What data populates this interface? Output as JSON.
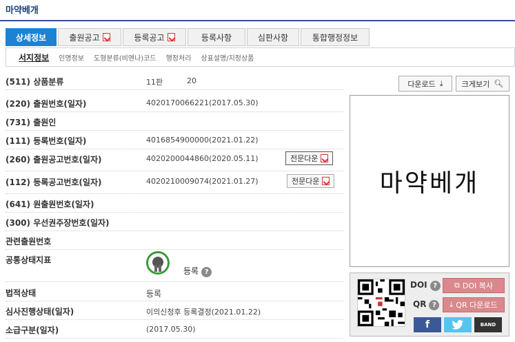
{
  "page": {
    "title": "마약베개"
  },
  "tabs": [
    {
      "label": "상세정보",
      "active": true
    },
    {
      "label": "출원공고",
      "pdf": true
    },
    {
      "label": "등록공고",
      "pdf": true
    },
    {
      "label": "등록사항"
    },
    {
      "label": "심판사항"
    },
    {
      "label": "통합행정정보"
    }
  ],
  "subtabs": [
    {
      "label": "서지정보",
      "active": true
    },
    {
      "label": "인명정보"
    },
    {
      "label": "도형분류(비엔나)코드"
    },
    {
      "label": "행정처리"
    },
    {
      "label": "상표설명/지정상품"
    }
  ],
  "rows": [
    {
      "label": "(511) 상품분류",
      "value": "11판",
      "value2": "20"
    },
    {
      "label": "(220) 출원번호(일자)",
      "value": "4020170066221(2017.05.30)"
    },
    {
      "label": "(731) 출원인",
      "value": ""
    },
    {
      "label": "(111) 등록번호(일자)",
      "value": "4016854900000(2021.01.22)"
    },
    {
      "label": "(260) 출원공고번호(일자)",
      "value": "4020200044860(2020.05.11)",
      "button": "전문다운"
    },
    {
      "label": "(112) 등록공고번호(일자)",
      "value": "4020210009074(2021.01.27)",
      "button": "전문다운"
    },
    {
      "label": "(641) 원출원번호(일자)",
      "value": ""
    },
    {
      "label": "(300) 우선권주장번호(일자)",
      "value": ""
    },
    {
      "label": "관련출원번호",
      "value": ""
    }
  ],
  "status": {
    "label": "공통상태지표",
    "value": "등록",
    "help": "?"
  },
  "rows_bottom": [
    {
      "label": "법적상태",
      "value": "등록"
    },
    {
      "label": "심사진행상태(일자)",
      "value": "이의신청후 등록결정(2021.01.22)"
    },
    {
      "label": "소급구분(일자)",
      "value": "(2017.05.30)"
    }
  ],
  "actions": {
    "download": "다운로드",
    "zoom": "크게보기"
  },
  "preview": {
    "mark_text": "마약베개"
  },
  "share": {
    "doi_label": "DOI",
    "qr_label": "QR",
    "doi_copy": "DOI 복사",
    "qr_download": "QR 다운로드",
    "facebook": "f",
    "band": "BAND"
  },
  "colors": {
    "accent": "#1b82d4",
    "title": "#1a3d7c",
    "share_button": "#d9888c",
    "facebook": "#3b5998",
    "twitter": "#55c5ef"
  }
}
